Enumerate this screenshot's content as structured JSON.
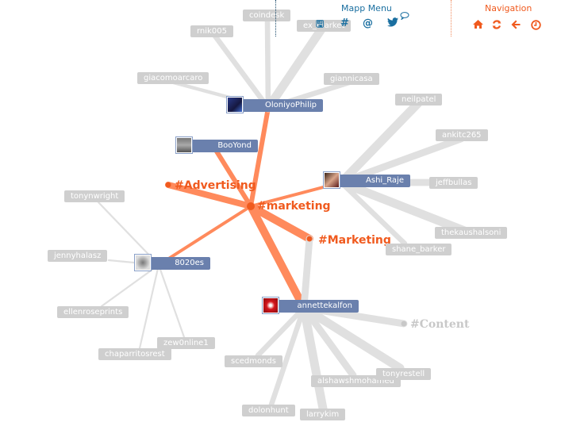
{
  "menus": {
    "mapp_menu": {
      "title": "Mapp Menu",
      "color": "#1a6fa0",
      "icons": [
        "save-icon",
        "hashtag-icon",
        "mention-icon",
        "twitter-icon",
        "comment-icon"
      ],
      "glyphs": {
        "save": "🖫",
        "hashtag": "#",
        "mention": "@",
        "twitter": "🐦",
        "comment": "💬"
      }
    },
    "navigation": {
      "title": "Navigation",
      "color": "#f05a1e",
      "icons": [
        "home-icon",
        "refresh-icon",
        "back-arrow-icon",
        "history-icon"
      ],
      "glyphs": {
        "home": "⌂",
        "refresh": "⟳",
        "back": "←",
        "history": "◷"
      }
    }
  },
  "colors": {
    "hub": "#ff8a5c",
    "hub_dot": "#f05a1e",
    "leaf_edge": "#e0e0e0",
    "user_bg": "#6a80ad",
    "leaf_bg": "#cfcfcf"
  },
  "hashtags": [
    {
      "id": "marketing",
      "label": "#marketing",
      "style": "primary"
    },
    {
      "id": "Advertising",
      "label": "#Advertising",
      "style": "primary"
    },
    {
      "id": "Marketing",
      "label": "#Marketing",
      "style": "primary"
    },
    {
      "id": "Content",
      "label": "#Content",
      "style": "muted"
    }
  ],
  "users": [
    {
      "id": "OloniyoPhilip",
      "label": "OloniyoPhilip"
    },
    {
      "id": "BooYond",
      "label": "BooYond"
    },
    {
      "id": "Ashi_Raje",
      "label": "Ashi_Raje"
    },
    {
      "id": "8020es",
      "label": "8020es"
    },
    {
      "id": "annettekalfon",
      "label": "annettekalfon"
    }
  ],
  "leaves": [
    {
      "id": "coindesk",
      "label": "coindesk",
      "parent": "OloniyoPhilip"
    },
    {
      "id": "ex_market",
      "label": "ex_market",
      "parent": "OloniyoPhilip"
    },
    {
      "id": "rnik005",
      "label": "rnik005",
      "parent": "OloniyoPhilip"
    },
    {
      "id": "giacomoarcaro",
      "label": "giacomoarcaro",
      "parent": "OloniyoPhilip"
    },
    {
      "id": "giannicasa",
      "label": "giannicasa",
      "parent": "OloniyoPhilip"
    },
    {
      "id": "neilpatel",
      "label": "neilpatel",
      "parent": "Ashi_Raje"
    },
    {
      "id": "ankitc265",
      "label": "ankitc265",
      "parent": "Ashi_Raje"
    },
    {
      "id": "jeffbullas",
      "label": "jeffbullas",
      "parent": "Ashi_Raje"
    },
    {
      "id": "thekaushalsoni",
      "label": "thekaushalsoni",
      "parent": "Ashi_Raje"
    },
    {
      "id": "shane_barker",
      "label": "shane_barker",
      "parent": "Ashi_Raje"
    },
    {
      "id": "tonynwright",
      "label": "tonynwright",
      "parent": "8020es"
    },
    {
      "id": "jennyhalasz",
      "label": "jennyhalasz",
      "parent": "8020es"
    },
    {
      "id": "ellenroseprints",
      "label": "ellenroseprints",
      "parent": "8020es"
    },
    {
      "id": "chaparritosrest",
      "label": "chaparritosrest",
      "parent": "8020es"
    },
    {
      "id": "zew0nline1",
      "label": "zew0nline1",
      "parent": "8020es"
    },
    {
      "id": "scedmonds",
      "label": "scedmonds",
      "parent": "annettekalfon"
    },
    {
      "id": "dolonhunt",
      "label": "dolonhunt",
      "parent": "annettekalfon"
    },
    {
      "id": "larrykim",
      "label": "larrykim",
      "parent": "annettekalfon"
    },
    {
      "id": "alshawshmohamed",
      "label": "alshawshmohamed",
      "parent": "annettekalfon"
    },
    {
      "id": "tonyrestell",
      "label": "tonyrestell",
      "parent": "annettekalfon"
    }
  ],
  "edges": [
    {
      "from": "marketing",
      "to": "OloniyoPhilip",
      "kind": "hub",
      "weight": 3
    },
    {
      "from": "marketing",
      "to": "BooYond",
      "kind": "hub",
      "weight": 3
    },
    {
      "from": "marketing",
      "to": "Advertising",
      "kind": "hub",
      "weight": 4
    },
    {
      "from": "marketing",
      "to": "Ashi_Raje",
      "kind": "hub",
      "weight": 2
    },
    {
      "from": "marketing",
      "to": "8020es",
      "kind": "hub",
      "weight": 2
    },
    {
      "from": "marketing",
      "to": "Marketing",
      "kind": "hub",
      "weight": 5
    },
    {
      "from": "marketing",
      "to": "annettekalfon",
      "kind": "hub",
      "weight": 5
    },
    {
      "from": "Marketing",
      "to": "annettekalfon",
      "kind": "leaf",
      "weight": 4
    },
    {
      "from": "annettekalfon",
      "to": "Content",
      "kind": "leaf",
      "weight": 4
    },
    {
      "from": "OloniyoPhilip",
      "to": "coindesk",
      "kind": "leaf",
      "weight": 3
    },
    {
      "from": "OloniyoPhilip",
      "to": "ex_market",
      "kind": "leaf",
      "weight": 5
    },
    {
      "from": "OloniyoPhilip",
      "to": "rnik005",
      "kind": "leaf",
      "weight": 3
    },
    {
      "from": "OloniyoPhilip",
      "to": "giacomoarcaro",
      "kind": "leaf",
      "weight": 2
    },
    {
      "from": "OloniyoPhilip",
      "to": "giannicasa",
      "kind": "leaf",
      "weight": 3
    },
    {
      "from": "Ashi_Raje",
      "to": "neilpatel",
      "kind": "leaf",
      "weight": 5
    },
    {
      "from": "Ashi_Raje",
      "to": "ankitc265",
      "kind": "leaf",
      "weight": 4
    },
    {
      "from": "Ashi_Raje",
      "to": "jeffbullas",
      "kind": "leaf",
      "weight": 4
    },
    {
      "from": "Ashi_Raje",
      "to": "thekaushalsoni",
      "kind": "leaf",
      "weight": 5
    },
    {
      "from": "Ashi_Raje",
      "to": "shane_barker",
      "kind": "leaf",
      "weight": 3
    },
    {
      "from": "8020es",
      "to": "tonynwright",
      "kind": "leaf",
      "weight": 1
    },
    {
      "from": "8020es",
      "to": "jennyhalasz",
      "kind": "leaf",
      "weight": 1
    },
    {
      "from": "8020es",
      "to": "ellenroseprints",
      "kind": "leaf",
      "weight": 1
    },
    {
      "from": "8020es",
      "to": "chaparritosrest",
      "kind": "leaf",
      "weight": 1
    },
    {
      "from": "8020es",
      "to": "zew0nline1",
      "kind": "leaf",
      "weight": 1
    },
    {
      "from": "annettekalfon",
      "to": "scedmonds",
      "kind": "leaf",
      "weight": 3
    },
    {
      "from": "annettekalfon",
      "to": "dolonhunt",
      "kind": "leaf",
      "weight": 3
    },
    {
      "from": "annettekalfon",
      "to": "larrykim",
      "kind": "leaf",
      "weight": 5
    },
    {
      "from": "annettekalfon",
      "to": "alshawshmohamed",
      "kind": "leaf",
      "weight": 4
    },
    {
      "from": "annettekalfon",
      "to": "tonyrestell",
      "kind": "leaf",
      "weight": 5
    }
  ]
}
